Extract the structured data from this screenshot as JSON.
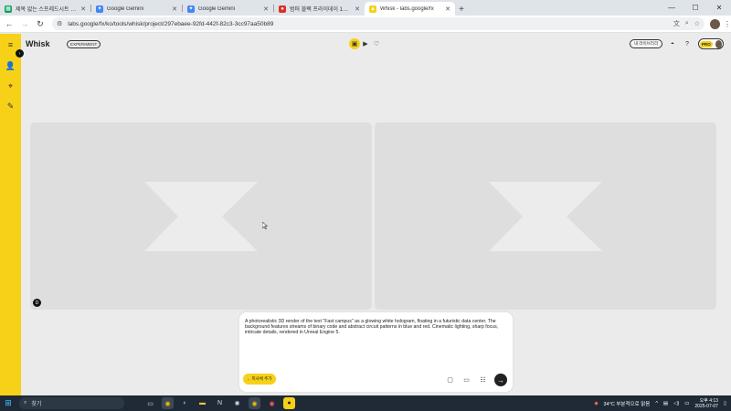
{
  "browser": {
    "tabs": [
      {
        "title": "제목 없는 스프레드시트 - Go...",
        "favicon": "sheets-icon",
        "color": "#0f9d58",
        "glyph": "▦",
        "active": false
      },
      {
        "title": "Google Gemini",
        "favicon": "gemini-icon",
        "color": "#4285f4",
        "glyph": "✦",
        "active": false
      },
      {
        "title": "Google Gemini",
        "favicon": "gemini-icon",
        "color": "#4285f4",
        "glyph": "✦",
        "active": false
      },
      {
        "title": "범퍼 블랙 프라이데이 1+1 무...",
        "favicon": "shop-icon",
        "color": "#d93025",
        "glyph": "●",
        "active": false
      },
      {
        "title": "Whisk - labs.google/fx",
        "favicon": "whisk-icon",
        "color": "#f7d117",
        "glyph": "▲",
        "active": true
      }
    ],
    "url": "labs.google/fx/ko/tools/whisk/project/297ebaee-92fd-442f-82c3-3cc97aa50b89"
  },
  "app": {
    "name": "Whisk",
    "badge": "EXPERIMENT",
    "gallery_label": "내 라이브러리",
    "pro_label": "PRO"
  },
  "prompt": {
    "text": "A photorealistic 3D render of the text \"Fast campus\" as a glowing white hologram, floating in a futuristic data center. The background features streams of binary code and abstract circuit patterns in blue and red. Cinematic lighting, sharp focus, intricate details, rendered in Unreal Engine 5.",
    "add_subject_label": "피사체 추가"
  },
  "taskbar": {
    "search_placeholder": "찾기",
    "weather": "34°C 부분적으로 맑음",
    "time": "오후 4:13",
    "date": "2025-07-07"
  },
  "colors": {
    "accent": "#f7d117",
    "panel": "#dedede",
    "placeholder_shape": "#ececec"
  }
}
